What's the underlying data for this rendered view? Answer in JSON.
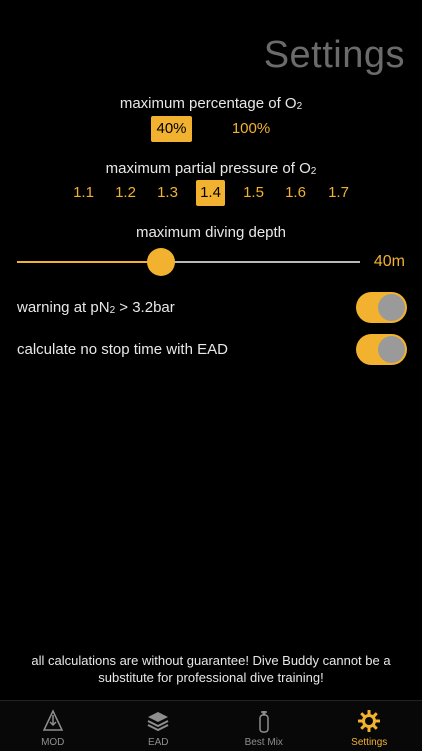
{
  "header": {
    "title": "Settings"
  },
  "o2_percentage": {
    "label": "maximum percentage of O",
    "label_sub": "2",
    "options": [
      "40%",
      "100%"
    ],
    "selected": "40%"
  },
  "o2_pressure": {
    "label": "maximum partial pressure of O",
    "label_sub": "2",
    "options": [
      "1.1",
      "1.2",
      "1.3",
      "1.4",
      "1.5",
      "1.6",
      "1.7"
    ],
    "selected": "1.4"
  },
  "depth": {
    "label": "maximum diving depth",
    "value_label": "40m",
    "slider_fraction": 0.42
  },
  "warning": {
    "label_prefix": "warning at pN",
    "label_sub": "2",
    "label_suffix": " > 3.2bar",
    "enabled": true
  },
  "no_stop": {
    "label": "calculate no stop time with EAD",
    "enabled": true
  },
  "disclaimer": "all calculations are without guarantee! Dive Buddy cannot be a substitute for professional dive training!",
  "tabs": [
    {
      "label": "MOD",
      "icon": "mod-icon"
    },
    {
      "label": "EAD",
      "icon": "layers-icon"
    },
    {
      "label": "Best Mix",
      "icon": "tank-icon"
    },
    {
      "label": "Settings",
      "icon": "gear-icon",
      "active": true
    }
  ],
  "colors": {
    "accent": "#f2b230",
    "background": "#000000",
    "title": "#6b6b6b",
    "text": "#e8e8e8",
    "inactive_tab": "#8e8e8e"
  }
}
